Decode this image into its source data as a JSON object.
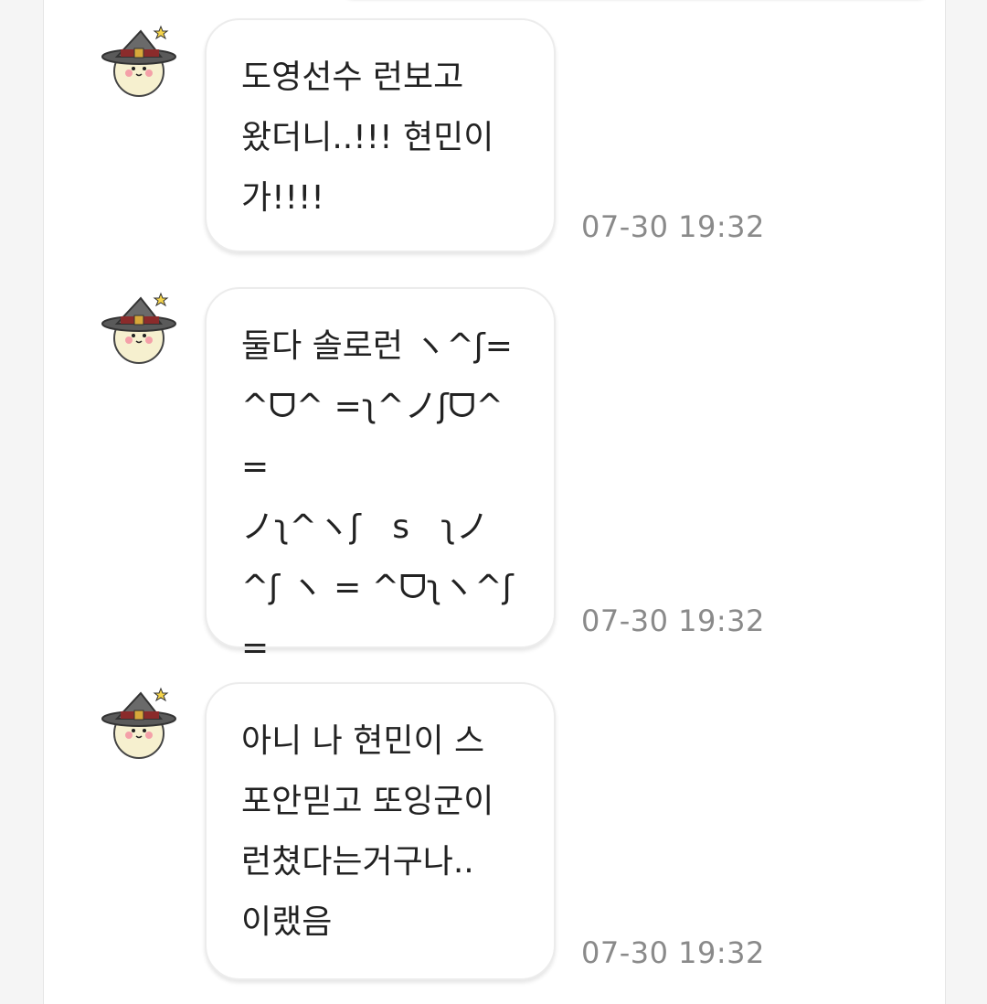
{
  "chat": {
    "messages": [
      {
        "text": "도영선수 런보고\n왔더니..!!! 현민이\n가!!!!",
        "time": "07-30 19:32"
      },
      {
        "text": "둘다 솔로런 ヽ^ʃ=\n^ᗜ^ =ʅ^ノʃᗜ^ =\nノʅ^ヽʃ   s   ʅノ\n^ʃ ヽ = ^ᗜʅヽ^ʃ=\n^ᗜ^ =ʅ^ノ",
        "time": "07-30 19:32"
      },
      {
        "text": "아니 나 현민이 스\n포안믿고 또잉군이\n런쳤다는거구나..\n이랬음",
        "time": "07-30 19:32"
      }
    ]
  },
  "icons": {
    "avatar": "witch-hat-character-avatar-icon"
  },
  "colors": {
    "background": "#f5f5f5",
    "bubble": "#ffffff",
    "timestamp": "#8a8a8a",
    "text": "#222222"
  }
}
